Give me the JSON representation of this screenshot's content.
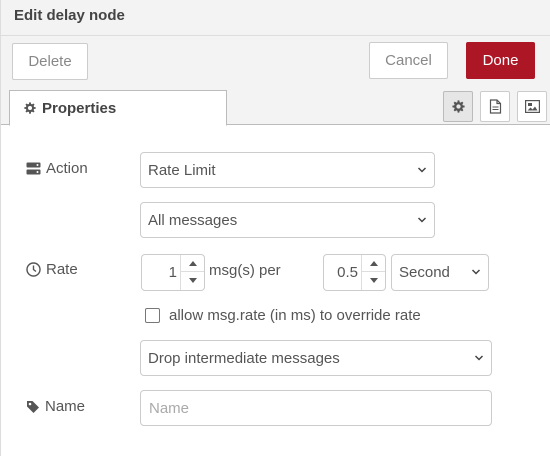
{
  "header": {
    "title": "Edit delay node"
  },
  "toolbar": {
    "delete_label": "Delete",
    "cancel_label": "Cancel",
    "done_label": "Done"
  },
  "tabs": {
    "properties_label": "Properties"
  },
  "form": {
    "action_label": "Action",
    "action_value": "Rate Limit",
    "scope_value": "All messages",
    "rate_label": "Rate",
    "rate_count": "1",
    "rate_count_unit": "msg(s) per",
    "rate_interval": "0.5",
    "rate_units": "Second",
    "override_label": "allow msg.rate (in ms) to override rate",
    "override_checked": false,
    "drop_value": "Drop intermediate messages",
    "name_label": "Name",
    "name_value": "",
    "name_placeholder": "Name"
  },
  "colors": {
    "done_button": "#ad1625",
    "header_bg": "#f3f3f3"
  },
  "icons": [
    "gear-icon",
    "document-icon",
    "image-icon",
    "server-icon",
    "clock-icon",
    "tag-icon",
    "chevron-down-icon"
  ]
}
